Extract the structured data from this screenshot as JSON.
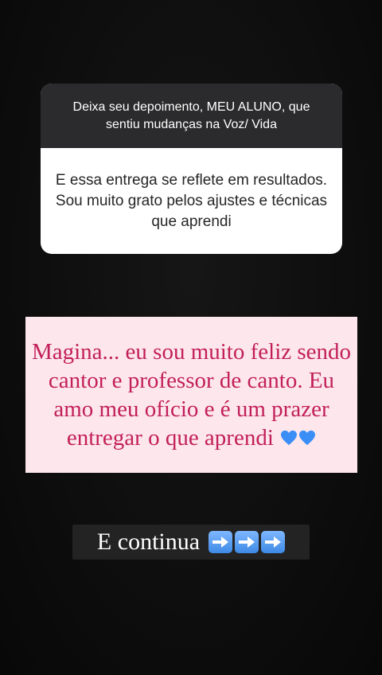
{
  "question_sticker": {
    "question": "Deixa seu depoimento, MEU ALUNO, que sentiu mudanças na Voz/ Vida",
    "answer": "E essa entrega se reflete em resultados. Sou muito grato pelos ajustes e técnicas que aprendi"
  },
  "reply": {
    "text": "Magina... eu sou muito feliz sendo cantor e professor de canto. Eu amo meu ofício e é um prazer entregar o que aprendi",
    "emoji_icons": [
      "blue-heart-icon",
      "blue-heart-icon"
    ]
  },
  "continue_label": {
    "text": "E continua",
    "emoji_icons": [
      "right-arrow-icon",
      "right-arrow-icon",
      "right-arrow-icon"
    ]
  },
  "colors": {
    "background": "#0f0f0f",
    "question_header": "#2b2b2d",
    "reply_background": "#fde7ec",
    "reply_text": "#c21f5a",
    "heart": "#3a8ef6"
  }
}
